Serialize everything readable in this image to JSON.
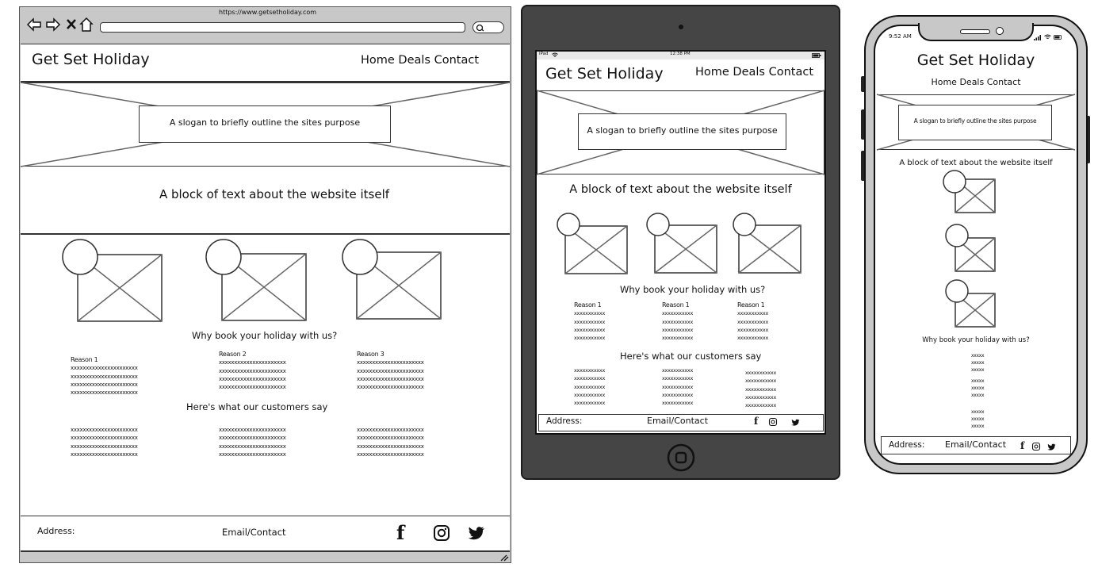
{
  "desktop": {
    "url": "https://www.getsetholiday.com",
    "site_title": "Get Set Holiday",
    "nav": "Home Deals Contact",
    "slogan": "A slogan to briefly outline the sites purpose",
    "about": "A block of text about the website itself",
    "why_heading": "Why book your holiday with us?",
    "reasons": [
      {
        "title": "Reason 1",
        "lines": [
          "xxxxxxxxxxxxxxxxxxxxxx",
          "xxxxxxxxxxxxxxxxxxxxxx",
          "xxxxxxxxxxxxxxxxxxxxxx",
          "xxxxxxxxxxxxxxxxxxxxxx"
        ]
      },
      {
        "title": "Reason 2",
        "lines": [
          "xxxxxxxxxxxxxxxxxxxxxx",
          "xxxxxxxxxxxxxxxxxxxxxx",
          "xxxxxxxxxxxxxxxxxxxxxx",
          "xxxxxxxxxxxxxxxxxxxxxx"
        ]
      },
      {
        "title": "Reason 3",
        "lines": [
          "xxxxxxxxxxxxxxxxxxxxxx",
          "xxxxxxxxxxxxxxxxxxxxxx",
          "xxxxxxxxxxxxxxxxxxxxxx",
          "xxxxxxxxxxxxxxxxxxxxxx"
        ]
      }
    ],
    "customers_heading": "Here's what our customers say",
    "reviews": [
      [
        "xxxxxxxxxxxxxxxxxxxxxx",
        "xxxxxxxxxxxxxxxxxxxxxx",
        "xxxxxxxxxxxxxxxxxxxxxx",
        "xxxxxxxxxxxxxxxxxxxxxx"
      ],
      [
        "xxxxxxxxxxxxxxxxxxxxxx",
        "xxxxxxxxxxxxxxxxxxxxxx",
        "xxxxxxxxxxxxxxxxxxxxxx",
        "xxxxxxxxxxxxxxxxxxxxxx"
      ],
      [
        "xxxxxxxxxxxxxxxxxxxxxx",
        "xxxxxxxxxxxxxxxxxxxxxx",
        "xxxxxxxxxxxxxxxxxxxxxx",
        "xxxxxxxxxxxxxxxxxxxxxx"
      ]
    ],
    "footer": {
      "address": "Address:",
      "contact": "Email/Contact"
    }
  },
  "tablet": {
    "status_left": "iPad",
    "status_time": "12:38 PM",
    "site_title": "Get Set Holiday",
    "nav": "Home Deals Contact",
    "slogan": "A slogan to briefly outline the sites purpose",
    "about": "A block of text about the website itself",
    "why_heading": "Why book your holiday with us?",
    "reasons": [
      {
        "title": "Reason 1",
        "lines": [
          "xxxxxxxxxxx",
          "xxxxxxxxxxx",
          "xxxxxxxxxxx",
          "xxxxxxxxxxx"
        ]
      },
      {
        "title": "Reason 1",
        "lines": [
          "xxxxxxxxxxx",
          "xxxxxxxxxxx",
          "xxxxxxxxxxx",
          "xxxxxxxxxxx"
        ]
      },
      {
        "title": "Reason 1",
        "lines": [
          "xxxxxxxxxxx",
          "xxxxxxxxxxx",
          "xxxxxxxxxxx",
          "xxxxxxxxxxx"
        ]
      }
    ],
    "customers_heading": "Here's what our customers say",
    "reviews": [
      [
        "xxxxxxxxxxx",
        "xxxxxxxxxxx",
        "xxxxxxxxxxx",
        "xxxxxxxxxxx",
        "xxxxxxxxxxx"
      ],
      [
        "xxxxxxxxxxx",
        "xxxxxxxxxxx",
        "xxxxxxxxxxx",
        "xxxxxxxxxxx",
        "xxxxxxxxxxx"
      ],
      [
        "xxxxxxxxxxx",
        "xxxxxxxxxxx",
        "xxxxxxxxxxx",
        "xxxxxxxxxxx",
        "xxxxxxxxxxx"
      ]
    ],
    "footer": {
      "address": "Address:",
      "contact": "Email/Contact"
    }
  },
  "phone": {
    "status_time": "9:52 AM",
    "site_title": "Get Set Holiday",
    "nav": "Home Deals Contact",
    "slogan": "A slogan to briefly outline the sites purpose",
    "about": "A block of text about the website itself",
    "why_heading": "Why book your holiday with us?",
    "reason_groups": [
      [
        "xxxxx",
        "xxxxx",
        "xxxxx"
      ],
      [
        "xxxxx",
        "xxxxx",
        "xxxxx"
      ],
      [
        "xxxxx",
        "xxxxx",
        "xxxxx"
      ]
    ],
    "footer": {
      "address": "Address:",
      "contact": "Email/Contact"
    }
  },
  "colors": {
    "frame_dark": "#454545",
    "frame_grey": "#c8c8c8",
    "line": "#333333"
  },
  "icons": [
    "back-arrow-icon",
    "forward-arrow-icon",
    "close-icon",
    "home-icon",
    "search-icon",
    "facebook-icon",
    "instagram-icon",
    "twitter-icon",
    "wifi-icon",
    "battery-icon",
    "signal-icon",
    "home-button-icon",
    "resize-grip-icon"
  ]
}
